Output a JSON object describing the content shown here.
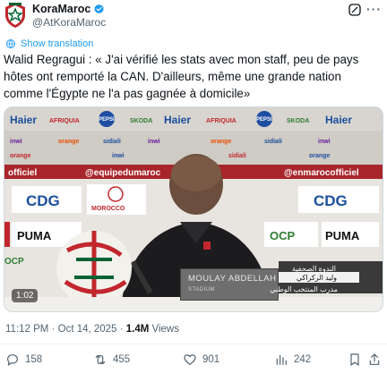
{
  "account": {
    "name": "KoraMaroc",
    "handle": "@AtKoraMaroc",
    "verified": true
  },
  "translate": {
    "label": "Show translation"
  },
  "tweet": {
    "text": "Walid Regragui : « J'ai vérifié les stats avec mon staff, peu de pays hôtes ont remporté la CAN. D'ailleurs, même une grande nation comme l'Égypte ne l'a pas gagnée à domicile»"
  },
  "media": {
    "duration": "1:02",
    "nameplate_title": "MOULAY ABDELLAH",
    "nameplate_sub": "STADIUM",
    "lower_third_top": "الندوة الصحفية",
    "lower_third_name": "وليد الركراكي",
    "lower_third_role": "مدرب المنتخب الوطني",
    "sponsor_text": "Haier",
    "hashtag": "@equipedumaroc",
    "brand_official": "officiel",
    "brand_enmaroc": "@enmarocofficiel",
    "brand_cdg": "CDG",
    "brand_puma": "PUMA",
    "brand_ocp": "OCP",
    "brand_morocco": "MOROCCO",
    "brand_inwi": "inwi",
    "brand_orange": "orange",
    "brand_sidiali": "sidiali",
    "brand_afriquia": "AFRIQUIA",
    "brand_pepsi": "PEPSI",
    "brand_skoda": "SKODA"
  },
  "meta": {
    "time": "11:12 PM",
    "date": "Oct 14, 2025",
    "separator": "·",
    "views": "1.4M",
    "views_label": "Views"
  },
  "actions": {
    "replies": "158",
    "reposts": "455",
    "likes": "901",
    "bookmarks": "242"
  },
  "colors": {
    "accent": "#1d9bf0",
    "text": "#0f1419",
    "muted": "#536471",
    "jersey_red": "#c1272d",
    "jersey_green": "#006233"
  },
  "icons": [
    "avatar-crest-icon",
    "verified-badge-icon",
    "grok-icon",
    "more-icon",
    "globe-icon",
    "reply-icon",
    "repost-icon",
    "like-icon",
    "views-icon",
    "bookmark-icon",
    "share-icon"
  ]
}
